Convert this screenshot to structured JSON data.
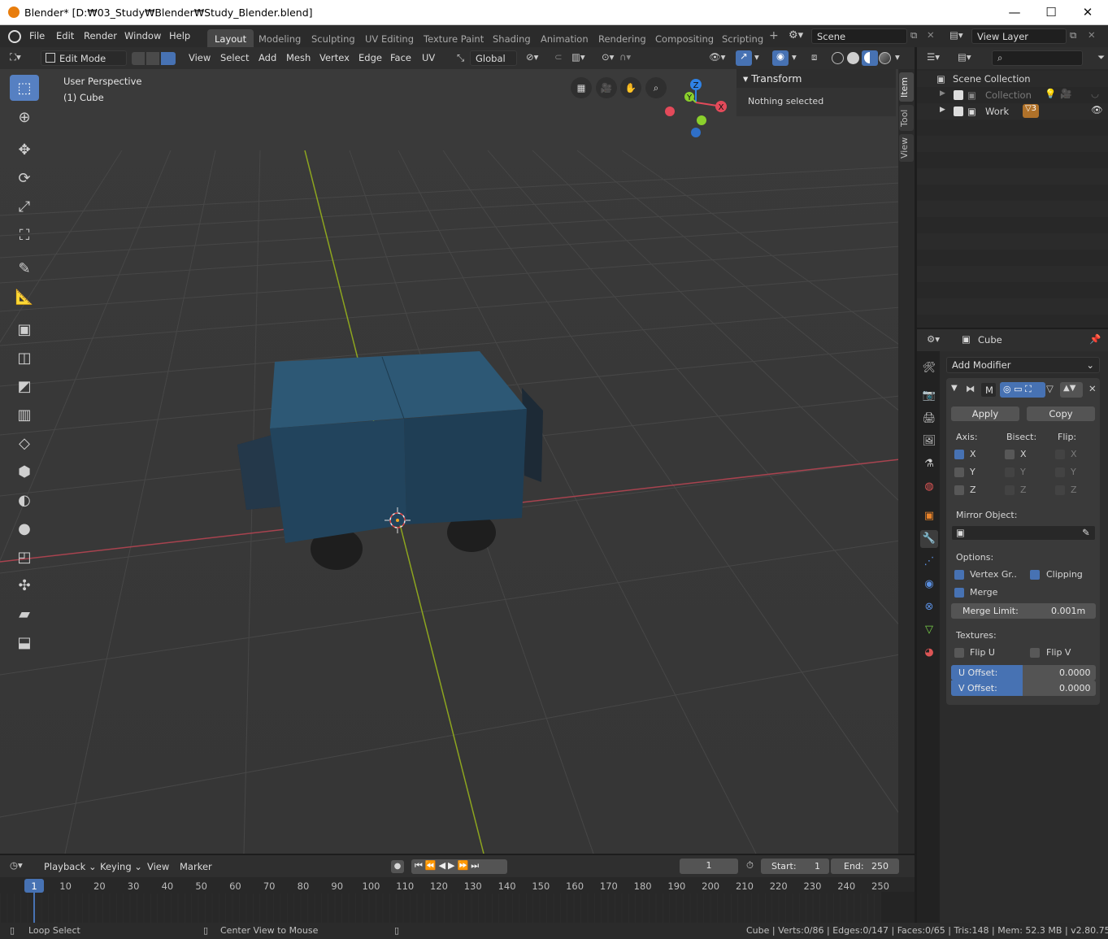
{
  "window": {
    "title": "Blender* [D:₩03_Study₩Blender₩Study_Blender.blend]"
  },
  "menubar": {
    "file": "File",
    "edit": "Edit",
    "render": "Render",
    "window": "Window",
    "help": "Help"
  },
  "workspaces": [
    "Layout",
    "Modeling",
    "Sculpting",
    "UV Editing",
    "Texture Paint",
    "Shading",
    "Animation",
    "Rendering",
    "Compositing",
    "Scripting"
  ],
  "active_workspace": "Layout",
  "scene": {
    "name": "Scene",
    "view_layer": "View Layer"
  },
  "header3d": {
    "mode": "Edit Mode",
    "view": "View",
    "select": "Select",
    "add": "Add",
    "mesh": "Mesh",
    "vertex": "Vertex",
    "edge": "Edge",
    "face": "Face",
    "uv": "UV",
    "orientation": "Global"
  },
  "viewport": {
    "perspective": "User Perspective",
    "object": "(1) Cube",
    "gizmo": {
      "x": "X",
      "y": "Y",
      "z": "Z"
    }
  },
  "npanel": {
    "header": "Transform",
    "body": "Nothing selected",
    "tabs": [
      "Item",
      "Tool",
      "View"
    ]
  },
  "outliner": {
    "root": "Scene Collection",
    "items": [
      {
        "name": "Collection",
        "dim": true
      },
      {
        "name": "Work",
        "badge": "3"
      }
    ]
  },
  "properties": {
    "object": "Cube",
    "add_modifier": "Add Modifier",
    "modifier_name": "M",
    "apply": "Apply",
    "copy": "Copy",
    "axis_label": "Axis:",
    "bisect_label": "Bisect:",
    "flip_label": "Flip:",
    "axes": [
      "X",
      "Y",
      "Z"
    ],
    "axis_checked": [
      true,
      false,
      false
    ],
    "mirror_object_label": "Mirror Object:",
    "options_label": "Options:",
    "vertex_groups": "Vertex Gr..",
    "clipping": "Clipping",
    "merge": "Merge",
    "merge_limit_label": "Merge Limit:",
    "merge_limit_value": "0.001m",
    "textures_label": "Textures:",
    "flip_u": "Flip U",
    "flip_v": "Flip V",
    "u_offset_label": "U Offset:",
    "u_offset_value": "0.0000",
    "v_offset_label": "V Offset:",
    "v_offset_value": "0.0000"
  },
  "timeline": {
    "playback": "Playback",
    "keying": "Keying",
    "view": "View",
    "marker": "Marker",
    "current_frame": "1",
    "start_label": "Start:",
    "start": "1",
    "end_label": "End:",
    "end": "250",
    "ticks": [
      "1",
      "10",
      "20",
      "30",
      "40",
      "50",
      "60",
      "70",
      "80",
      "90",
      "100",
      "110",
      "120",
      "130",
      "140",
      "150",
      "160",
      "170",
      "180",
      "190",
      "200",
      "210",
      "220",
      "230",
      "240",
      "250"
    ]
  },
  "statusbar": {
    "left": "Loop Select",
    "middle": "Center View to Mouse",
    "stats": "Cube | Verts:0/86 | Edges:0/147 | Faces:0/65 | Tris:148 | Mem: 52.3 MB | v2.80.75"
  },
  "colors": {
    "accent": "#4772b3",
    "axis_x": "#e34a5a",
    "axis_y": "#8bd02c",
    "axis_z": "#2f82e6",
    "cube": "#264a61"
  }
}
